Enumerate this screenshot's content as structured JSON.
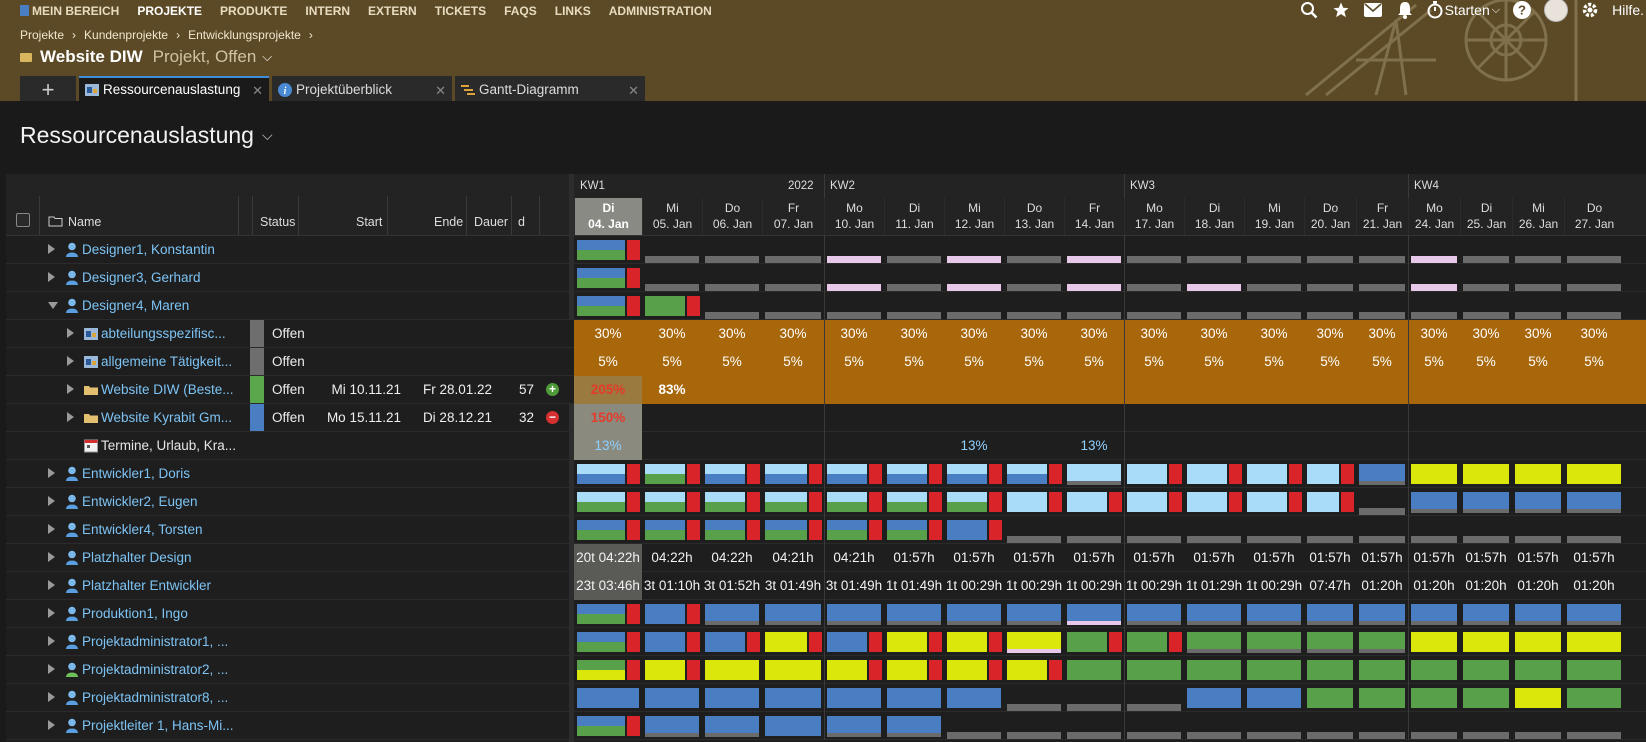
{
  "nav": {
    "items": [
      "MEIN BEREICH",
      "PROJEKTE",
      "PRODUKTE",
      "INTERN",
      "EXTERN",
      "TICKETS",
      "FAQS",
      "LINKS",
      "ADMINISTRATION"
    ],
    "active_index": 1
  },
  "topbar": {
    "starten_label": "Starten",
    "help_label": "Hilfe."
  },
  "breadcrumb": [
    "Projekte",
    "Kundenprojekte",
    "Entwicklungsprojekte"
  ],
  "project": {
    "title": "Website DIW",
    "status": "Projekt, Offen"
  },
  "tabs": [
    {
      "label": "Ressourcenauslastung",
      "active": true,
      "icon": "resource-icon"
    },
    {
      "label": "Projektüberblick",
      "active": false,
      "icon": "info-icon"
    },
    {
      "label": "Gantt-Diagramm",
      "active": false,
      "icon": "gantt-icon"
    }
  ],
  "page_title": "Ressourcenauslastung",
  "columns": {
    "name": "Name",
    "status": "Status",
    "start": "Start",
    "end": "Ende",
    "duration": "Dauer",
    "d": "d"
  },
  "calendar": {
    "weeks": [
      {
        "label": "KW1",
        "year": "2022"
      },
      {
        "label": "KW2",
        "year": ""
      },
      {
        "label": "KW3",
        "year": ""
      },
      {
        "label": "KW4",
        "year": ""
      }
    ],
    "days": [
      {
        "wd": "Di",
        "date": "04. Jan",
        "today": true
      },
      {
        "wd": "Mi",
        "date": "05. Jan"
      },
      {
        "wd": "Do",
        "date": "06. Jan"
      },
      {
        "wd": "Fr",
        "date": "07. Jan"
      },
      {
        "wd": "Mo",
        "date": "10. Jan"
      },
      {
        "wd": "Di",
        "date": "11. Jan"
      },
      {
        "wd": "Mi",
        "date": "12. Jan"
      },
      {
        "wd": "Do",
        "date": "13. Jan"
      },
      {
        "wd": "Fr",
        "date": "14. Jan"
      },
      {
        "wd": "Mo",
        "date": "17. Jan"
      },
      {
        "wd": "Di",
        "date": "18. Jan"
      },
      {
        "wd": "Mi",
        "date": "19. Jan"
      },
      {
        "wd": "Do",
        "date": "20. Jan"
      },
      {
        "wd": "Fr",
        "date": "21. Jan"
      },
      {
        "wd": "Mo",
        "date": "24. Jan"
      },
      {
        "wd": "Di",
        "date": "25. Jan"
      },
      {
        "wd": "Mi",
        "date": "26. Jan"
      },
      {
        "wd": "Do",
        "date": "27. Jan"
      }
    ]
  },
  "colors": {
    "blue": "#4a7ec2",
    "green": "#58a04a",
    "red": "#d9242a",
    "gray": "#6b6b6b",
    "lightblue": "#a8dcf8",
    "yellow": "#dbe70b",
    "pink": "#e8c8e8",
    "orange": "#a8670b",
    "status_gray": "#6e6e6e",
    "status_green": "#5aa84c",
    "status_blue": "#4a7ec2"
  },
  "rows": [
    {
      "name": "Designer1, Konstantin",
      "level": 0,
      "icon": "person-icon",
      "kind": "person",
      "pattern": "A"
    },
    {
      "name": "Designer3, Gerhard",
      "level": 0,
      "icon": "person-icon",
      "kind": "person",
      "pattern": "B"
    },
    {
      "name": "Designer4, Maren",
      "level": 0,
      "icon": "person-icon",
      "kind": "person",
      "expanded": true,
      "pattern": "C"
    },
    {
      "name": "abteilungsspezifisc...",
      "level": 1,
      "icon": "task-icon",
      "kind": "task",
      "status": "Offen",
      "status_color": "status_gray",
      "cells": [
        "30%",
        "30%",
        "30%",
        "30%",
        "30%",
        "30%",
        "30%",
        "30%",
        "30%",
        "30%",
        "30%",
        "30%",
        "30%",
        "30%",
        "30%",
        "30%",
        "30%",
        "30%"
      ]
    },
    {
      "name": "allgemeine Tätigkeit...",
      "level": 1,
      "icon": "task-icon",
      "kind": "task",
      "status": "Offen",
      "status_color": "status_gray",
      "cells": [
        "5%",
        "5%",
        "5%",
        "5%",
        "5%",
        "5%",
        "5%",
        "5%",
        "5%",
        "5%",
        "5%",
        "5%",
        "5%",
        "5%",
        "5%",
        "5%",
        "5%",
        "5%"
      ]
    },
    {
      "name": "Website DIW (Beste...",
      "level": 1,
      "icon": "folder-icon",
      "kind": "project",
      "status": "Offen",
      "status_color": "status_green",
      "start": "Mi 10.11.21",
      "end": "Fr 28.01.22",
      "duration": "57",
      "action": "plus",
      "cells": [
        "205%",
        "83%"
      ]
    },
    {
      "name": "Website Kyrabit Gm...",
      "level": 1,
      "icon": "folder-icon",
      "kind": "project2",
      "status": "Offen",
      "status_color": "status_blue",
      "start": "Mo 15.11.21",
      "end": "Di 28.12.21",
      "duration": "32",
      "action": "minus",
      "cells": [
        "150%"
      ]
    },
    {
      "name": "Termine, Urlaub, Kra...",
      "level": 1,
      "icon": "calendar-icon",
      "kind": "appointments",
      "noexpander": true,
      "cells": [
        "13%",
        "",
        "",
        "",
        "",
        "",
        "13%",
        "",
        "13%"
      ]
    },
    {
      "name": "Entwickler1, Doris",
      "level": 0,
      "icon": "person-icon",
      "kind": "person",
      "pattern": "D"
    },
    {
      "name": "Entwickler2, Eugen",
      "level": 0,
      "icon": "person-icon",
      "kind": "person",
      "pattern": "E"
    },
    {
      "name": "Entwickler4, Torsten",
      "level": 0,
      "icon": "person-icon",
      "kind": "person",
      "pattern": "F"
    },
    {
      "name": "Platzhalter Design",
      "level": 0,
      "icon": "person-icon",
      "kind": "placeholder",
      "cells": [
        "20t 04:22h",
        "04:22h",
        "04:22h",
        "04:21h",
        "04:21h",
        "01:57h",
        "01:57h",
        "01:57h",
        "01:57h",
        "01:57h",
        "01:57h",
        "01:57h",
        "01:57h",
        "01:57h",
        "01:57h",
        "01:57h",
        "01:57h",
        "01:57h"
      ]
    },
    {
      "name": "Platzhalter Entwickler",
      "level": 0,
      "icon": "person-icon",
      "kind": "placeholder",
      "cells": [
        "23t 03:46h",
        "3t 01:10h",
        "3t 01:52h",
        "3t 01:49h",
        "3t 01:49h",
        "1t 01:49h",
        "1t 00:29h",
        "1t 00:29h",
        "1t 00:29h",
        "1t 00:29h",
        "1t 01:29h",
        "1t 00:29h",
        "07:47h",
        "01:20h",
        "01:20h",
        "01:20h",
        "01:20h",
        "01:20h"
      ]
    },
    {
      "name": "Produktion1, Ingo",
      "level": 0,
      "icon": "person-icon",
      "kind": "person",
      "pattern": "G"
    },
    {
      "name": "Projektadministrator1, ...",
      "level": 0,
      "icon": "person-icon",
      "kind": "person",
      "pattern": "H"
    },
    {
      "name": "Projektadministrator2, ...",
      "level": 0,
      "icon": "person-green-icon",
      "kind": "person",
      "pattern": "I"
    },
    {
      "name": "Projektadministrator8, ...",
      "level": 0,
      "icon": "person-icon",
      "kind": "person",
      "pattern": "J"
    },
    {
      "name": "Projektleiter 1, Hans-Mi...",
      "level": 0,
      "icon": "person-icon",
      "kind": "person",
      "pattern": "K"
    }
  ],
  "patterns": {
    "A": [
      [
        "blue",
        "green",
        "red"
      ],
      [
        "gray"
      ],
      [
        "gray"
      ],
      [
        "gray"
      ],
      [
        "pink"
      ],
      [
        "gray"
      ],
      [
        "pink"
      ],
      [
        "gray"
      ],
      [
        "pink"
      ],
      [
        "gray"
      ],
      [
        "gray"
      ],
      [
        "gray"
      ],
      [
        "gray"
      ],
      [
        "gray"
      ],
      [
        "pink"
      ],
      [
        "gray"
      ],
      [
        "gray"
      ],
      [
        "gray"
      ]
    ],
    "B": [
      [
        "blue",
        "green",
        "red"
      ],
      [
        "gray"
      ],
      [
        "gray"
      ],
      [
        "gray"
      ],
      [
        "pink"
      ],
      [
        "gray"
      ],
      [
        "pink"
      ],
      [
        "gray"
      ],
      [
        "pink"
      ],
      [
        "gray"
      ],
      [
        "pink"
      ],
      [
        "gray"
      ],
      [
        "gray"
      ],
      [
        "gray"
      ],
      [
        "pink"
      ],
      [
        "gray"
      ],
      [
        "gray"
      ],
      [
        "gray"
      ]
    ],
    "C": [
      [
        "blue",
        "green",
        "red"
      ],
      [
        "green",
        "red"
      ],
      [
        "gray"
      ],
      [
        "gray"
      ],
      [
        "gray"
      ],
      [
        "gray"
      ],
      [
        "gray"
      ],
      [
        "gray"
      ],
      [
        "gray"
      ],
      [
        "gray"
      ],
      [
        "gray"
      ],
      [
        "gray"
      ],
      [
        "gray"
      ],
      [
        "gray"
      ],
      [
        "gray"
      ],
      [
        "gray"
      ],
      [
        "gray"
      ],
      [
        "gray"
      ]
    ],
    "D": [
      [
        "lightblue",
        "blue",
        "red"
      ],
      [
        "lightblue",
        "green",
        "red"
      ],
      [
        "lightblue",
        "blue",
        "red"
      ],
      [
        "lightblue",
        "blue",
        "red"
      ],
      [
        "lightblue",
        "blue",
        "red"
      ],
      [
        "lightblue",
        "blue",
        "red"
      ],
      [
        "lightblue",
        "blue",
        "red"
      ],
      [
        "lightblue",
        "blue",
        "red"
      ],
      [
        "lightblue",
        "gray"
      ],
      [
        "lightblue",
        "red"
      ],
      [
        "lightblue",
        "red"
      ],
      [
        "lightblue",
        "red"
      ],
      [
        "lightblue",
        "red"
      ],
      [
        "blue",
        "gray"
      ],
      [
        "yellow"
      ],
      [
        "yellow"
      ],
      [
        "yellow"
      ],
      [
        "yellow"
      ]
    ],
    "E": [
      [
        "lightblue",
        "green",
        "red"
      ],
      [
        "lightblue",
        "green",
        "red"
      ],
      [
        "lightblue",
        "green",
        "red"
      ],
      [
        "lightblue",
        "green",
        "red"
      ],
      [
        "lightblue",
        "green",
        "red"
      ],
      [
        "lightblue",
        "green",
        "red"
      ],
      [
        "lightblue",
        "green",
        "red"
      ],
      [
        "lightblue",
        "red"
      ],
      [
        "lightblue",
        "red"
      ],
      [
        "lightblue",
        "red"
      ],
      [
        "lightblue",
        "red"
      ],
      [
        "lightblue",
        "red"
      ],
      [
        "lightblue",
        "red"
      ],
      [
        "gray"
      ],
      [
        "blue",
        "gray"
      ],
      [
        "blue",
        "gray"
      ],
      [
        "blue",
        "gray"
      ],
      [
        "blue",
        "gray"
      ]
    ],
    "F": [
      [
        "blue",
        "green",
        "red"
      ],
      [
        "blue",
        "green",
        "red"
      ],
      [
        "blue",
        "green",
        "red"
      ],
      [
        "blue",
        "green",
        "red"
      ],
      [
        "blue",
        "green",
        "red"
      ],
      [
        "blue",
        "green",
        "red"
      ],
      [
        "blue",
        "red"
      ],
      [
        "gray"
      ],
      [
        "gray"
      ],
      [
        "gray"
      ],
      [
        "gray"
      ],
      [
        "gray"
      ],
      [
        "gray"
      ],
      [
        "gray"
      ],
      [
        "gray"
      ],
      [
        "gray"
      ],
      [
        "gray"
      ],
      [
        "gray"
      ]
    ],
    "G": [
      [
        "blue",
        "green",
        "red"
      ],
      [
        "blue",
        "red"
      ],
      [
        "blue",
        "gray"
      ],
      [
        "blue",
        "gray"
      ],
      [
        "blue",
        "gray"
      ],
      [
        "blue",
        "gray"
      ],
      [
        "blue",
        "gray"
      ],
      [
        "blue",
        "gray"
      ],
      [
        "blue",
        "pink"
      ],
      [
        "blue",
        "gray"
      ],
      [
        "blue",
        "gray"
      ],
      [
        "blue",
        "gray"
      ],
      [
        "blue",
        "gray"
      ],
      [
        "blue",
        "gray"
      ],
      [
        "blue",
        "gray"
      ],
      [
        "blue",
        "gray"
      ],
      [
        "blue",
        "gray"
      ],
      [
        "blue",
        "gray"
      ]
    ],
    "H": [
      [
        "blue",
        "green",
        "red"
      ],
      [
        "blue",
        "red"
      ],
      [
        "blue",
        "red"
      ],
      [
        "yellow",
        "red"
      ],
      [
        "blue",
        "red"
      ],
      [
        "yellow",
        "red"
      ],
      [
        "yellow",
        "red"
      ],
      [
        "yellow",
        "pink"
      ],
      [
        "green",
        "red"
      ],
      [
        "green",
        "red"
      ],
      [
        "green",
        "gray"
      ],
      [
        "green",
        "gray"
      ],
      [
        "green",
        "gray"
      ],
      [
        "green",
        "gray"
      ],
      [
        "yellow"
      ],
      [
        "yellow"
      ],
      [
        "yellow"
      ],
      [
        "yellow"
      ]
    ],
    "I": [
      [
        "green",
        "yellow",
        "red"
      ],
      [
        "yellow",
        "red"
      ],
      [
        "yellow"
      ],
      [
        "yellow"
      ],
      [
        "yellow",
        "red"
      ],
      [
        "yellow",
        "red"
      ],
      [
        "yellow",
        "red"
      ],
      [
        "yellow",
        "red"
      ],
      [
        "green"
      ],
      [
        "green"
      ],
      [
        "green"
      ],
      [
        "green"
      ],
      [
        "green"
      ],
      [
        "green"
      ],
      [
        "green"
      ],
      [
        "green"
      ],
      [
        "green"
      ],
      [
        "green"
      ]
    ],
    "J": [
      [
        "blue"
      ],
      [
        "blue"
      ],
      [
        "blue"
      ],
      [
        "blue"
      ],
      [
        "blue"
      ],
      [
        "blue"
      ],
      [
        "blue"
      ],
      [
        "gray"
      ],
      [
        "gray"
      ],
      [
        "gray"
      ],
      [
        "blue"
      ],
      [
        "blue"
      ],
      [
        "green"
      ],
      [
        "green"
      ],
      [
        "green"
      ],
      [
        "green"
      ],
      [
        "yellow"
      ],
      [
        "green"
      ]
    ],
    "K": [
      [
        "blue",
        "green",
        "red"
      ],
      [
        "blue",
        "gray"
      ],
      [
        "blue",
        "gray"
      ],
      [
        "blue"
      ],
      [
        "blue",
        "gray"
      ],
      [
        "blue",
        "gray"
      ],
      [
        "gray"
      ],
      [
        "gray"
      ],
      [
        "gray"
      ],
      [
        "gray"
      ],
      [
        "gray"
      ],
      [
        "gray"
      ],
      [
        "gray"
      ],
      [
        "gray"
      ],
      [
        "gray"
      ],
      [
        "gray"
      ],
      [
        "gray"
      ],
      [
        "gray"
      ]
    ]
  }
}
